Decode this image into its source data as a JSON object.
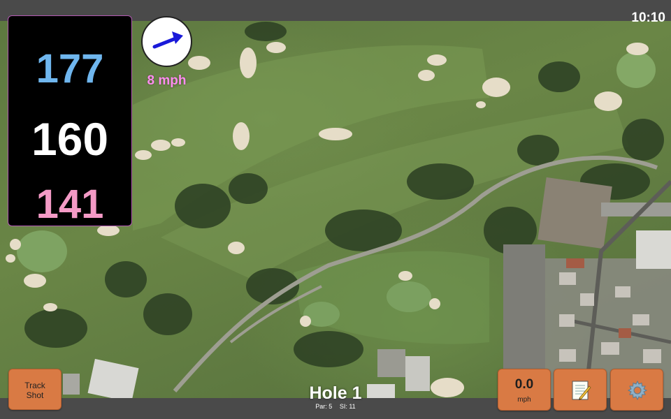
{
  "status_bar": {
    "time": "10:10"
  },
  "distances": {
    "back": "177",
    "middle": "160",
    "front": "141"
  },
  "wind": {
    "speed_label": "8 mph",
    "direction_icon": "wind-arrow-icon"
  },
  "hole": {
    "title": "Hole 1",
    "par": "Par: 5",
    "stroke_index": "SI: 11"
  },
  "buttons": {
    "track_shot_line1": "Track",
    "track_shot_line2": "Shot",
    "wind_value": "0.0",
    "wind_unit": "mph",
    "scorecard_icon": "scorecard-icon",
    "settings_icon": "gear-icon"
  },
  "colors": {
    "back_distance": "#6fb6ee",
    "middle_distance": "#ffffff",
    "front_distance": "#f49ac6",
    "wind_speed": "#ff8df0",
    "button": "#d97a44"
  }
}
